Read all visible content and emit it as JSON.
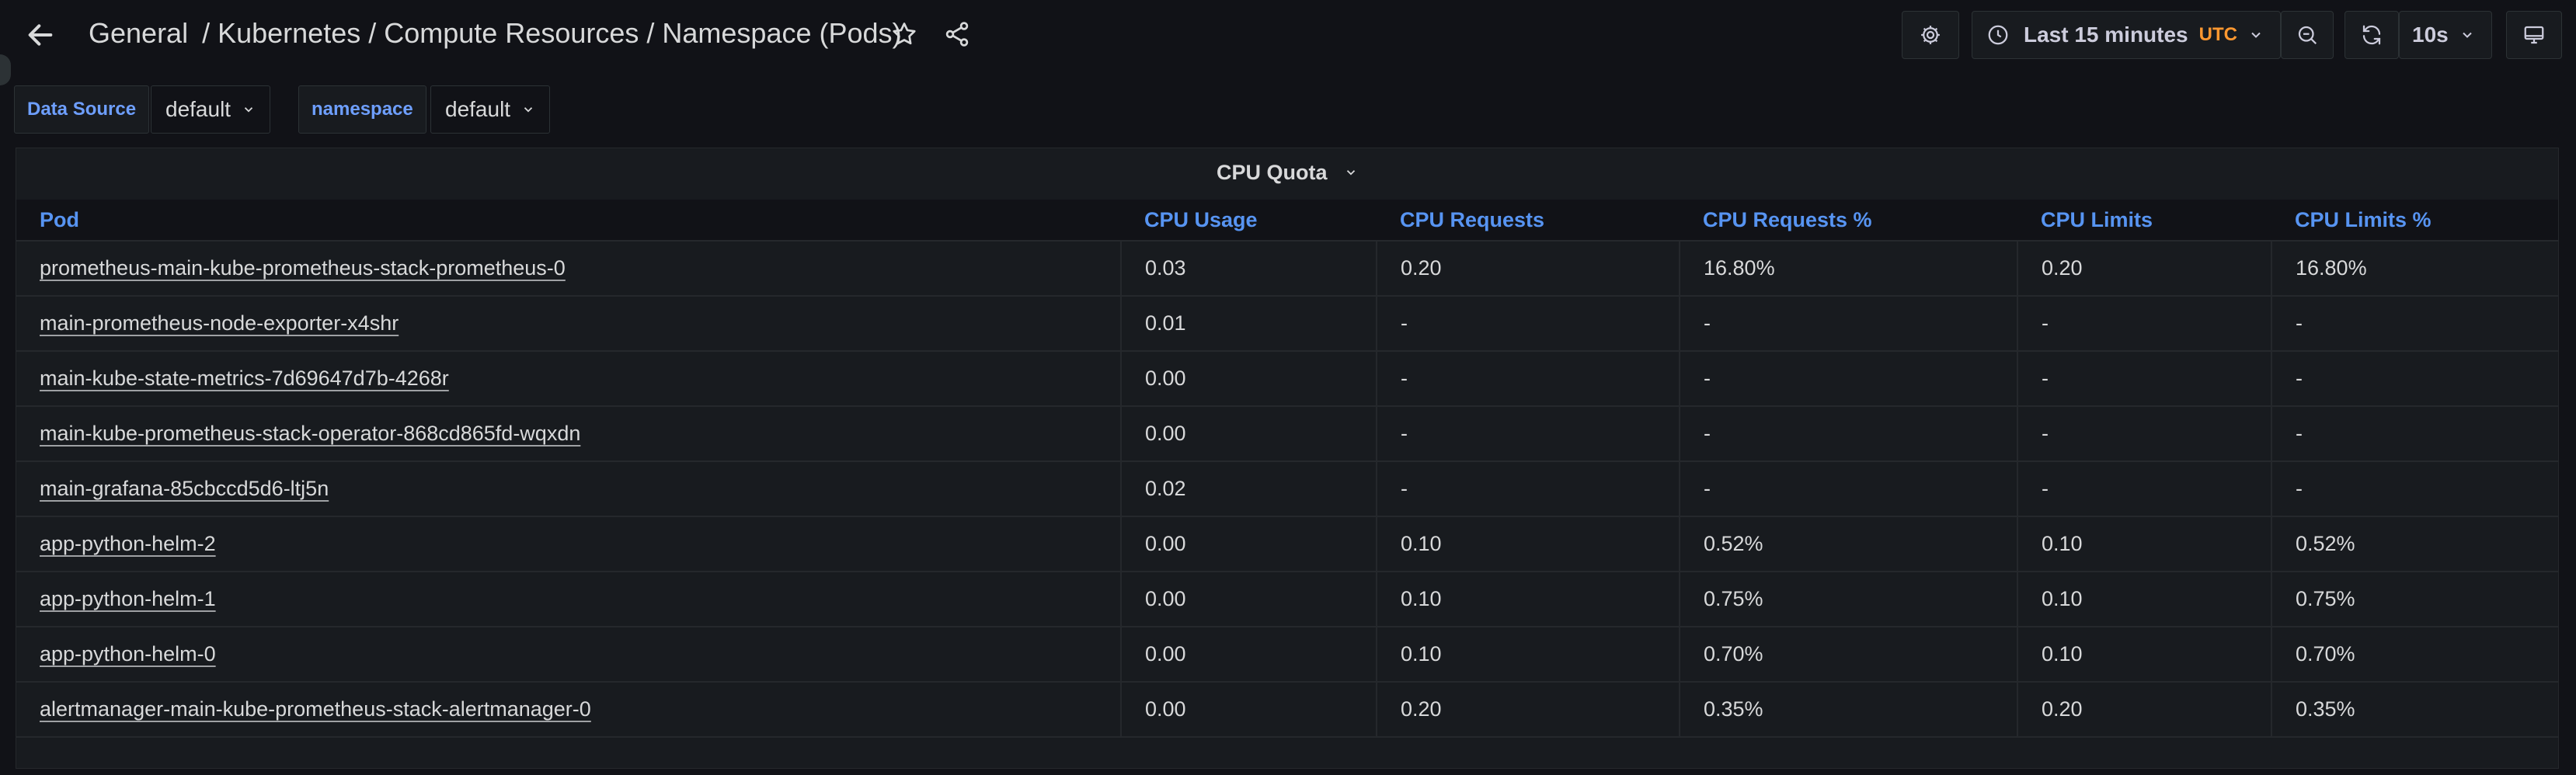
{
  "header": {
    "breadcrumb": [
      "General",
      "/ Kubernetes / Compute Resources / Namespace (Pods)"
    ],
    "time_range": "Last 15 minutes",
    "timezone": "UTC",
    "refresh": "10s",
    "icons": [
      "arrow-left-icon",
      "star-icon",
      "share-icon",
      "gear-icon",
      "clock-icon",
      "chevron-down-icon",
      "zoom-out-icon",
      "refresh-icon",
      "monitor-icon"
    ]
  },
  "variables": [
    {
      "label": "Data Source",
      "value": "default"
    },
    {
      "label": "namespace",
      "value": "default"
    }
  ],
  "panel": {
    "title": "CPU Quota",
    "columns": [
      "Pod",
      "CPU Usage",
      "CPU Requests",
      "CPU Requests %",
      "CPU Limits",
      "CPU Limits %"
    ],
    "rows": [
      [
        "prometheus-main-kube-prometheus-stack-prometheus-0",
        "0.03",
        "0.20",
        "16.80%",
        "0.20",
        "16.80%"
      ],
      [
        "main-prometheus-node-exporter-x4shr",
        "0.01",
        "-",
        "-",
        "-",
        "-"
      ],
      [
        "main-kube-state-metrics-7d69647d7b-4268r",
        "0.00",
        "-",
        "-",
        "-",
        "-"
      ],
      [
        "main-kube-prometheus-stack-operator-868cd865fd-wqxdn",
        "0.00",
        "-",
        "-",
        "-",
        "-"
      ],
      [
        "main-grafana-85cbccd5d6-ltj5n",
        "0.02",
        "-",
        "-",
        "-",
        "-"
      ],
      [
        "app-python-helm-2",
        "0.00",
        "0.10",
        "0.52%",
        "0.10",
        "0.52%"
      ],
      [
        "app-python-helm-1",
        "0.00",
        "0.10",
        "0.75%",
        "0.10",
        "0.75%"
      ],
      [
        "app-python-helm-0",
        "0.00",
        "0.10",
        "0.70%",
        "0.10",
        "0.70%"
      ],
      [
        "alertmanager-main-kube-prometheus-stack-alertmanager-0",
        "0.00",
        "0.20",
        "0.35%",
        "0.20",
        "0.35%"
      ]
    ]
  },
  "colors": {
    "background": "#111217",
    "panel": "#181b1f",
    "header_link": "#5794f2",
    "variable_label": "#6e9fff",
    "timezone": "#ff9830"
  }
}
